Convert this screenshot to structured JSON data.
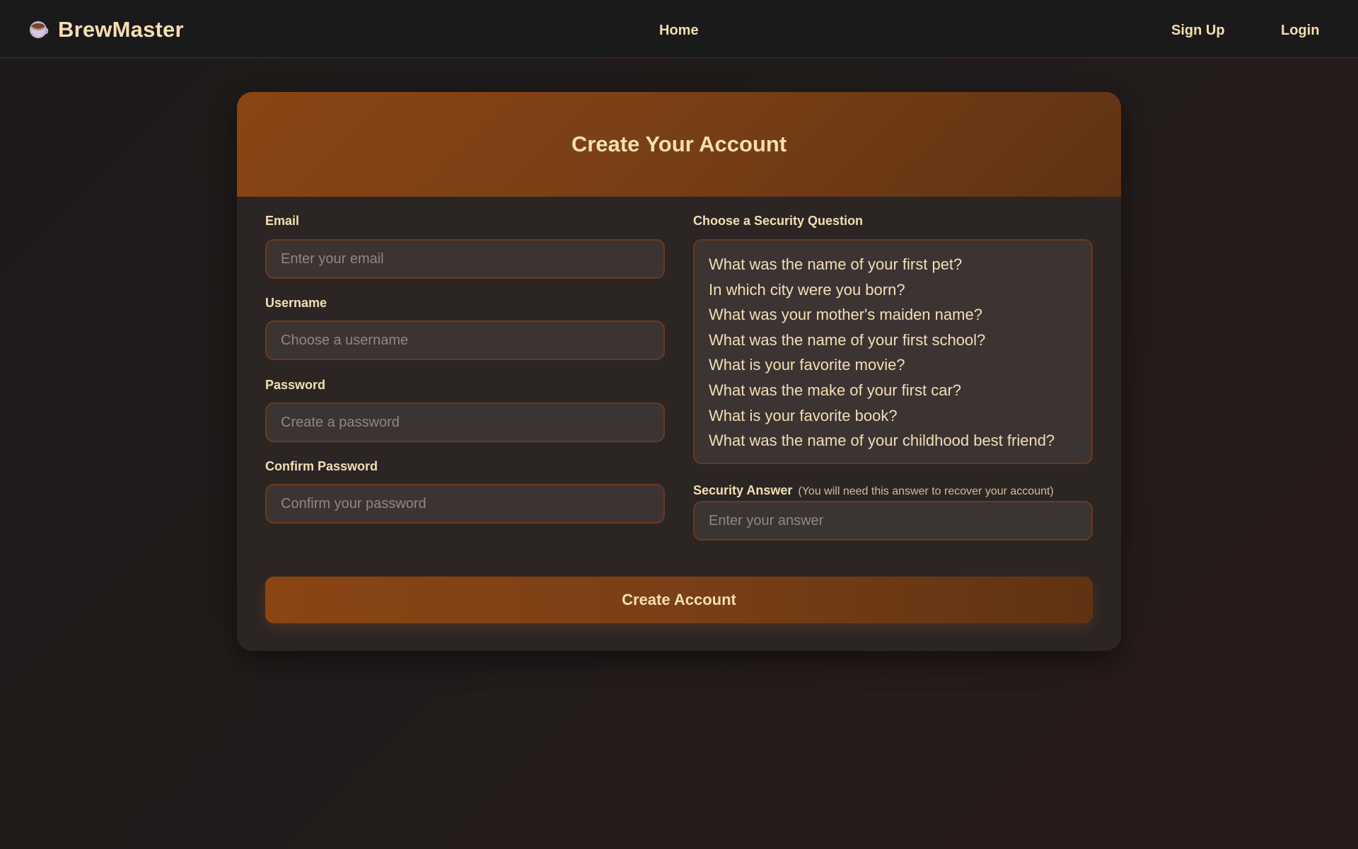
{
  "nav": {
    "brand": "BrewMaster",
    "brand_icon": "coffee-cup-icon",
    "links": {
      "home": "Home",
      "signup": "Sign Up",
      "login": "Login"
    }
  },
  "form": {
    "title": "Create Your Account",
    "email": {
      "label": "Email",
      "placeholder": "Enter your email",
      "value": ""
    },
    "username": {
      "label": "Username",
      "placeholder": "Choose a username",
      "value": ""
    },
    "password": {
      "label": "Password",
      "placeholder": "Create a password",
      "value": ""
    },
    "confirm_password": {
      "label": "Confirm Password",
      "placeholder": "Confirm your password",
      "value": ""
    },
    "security_question": {
      "label": "Choose a Security Question",
      "options": [
        "What was the name of your first pet?",
        "In which city were you born?",
        "What was your mother's maiden name?",
        "What was the name of your first school?",
        "What is your favorite movie?",
        "What was the make of your first car?",
        "What is your favorite book?",
        "What was the name of your childhood best friend?"
      ]
    },
    "security_answer": {
      "label": "Security Answer",
      "hint": "(You will need this answer to recover your account)",
      "placeholder": "Enter your answer",
      "value": ""
    },
    "submit_label": "Create Account"
  },
  "colors": {
    "accent": "#8b4513",
    "accent_dark": "#5f3312",
    "text": "#f5deb3",
    "background": "#1d1a19",
    "card": "#2b2524",
    "field": "#3b3433"
  }
}
